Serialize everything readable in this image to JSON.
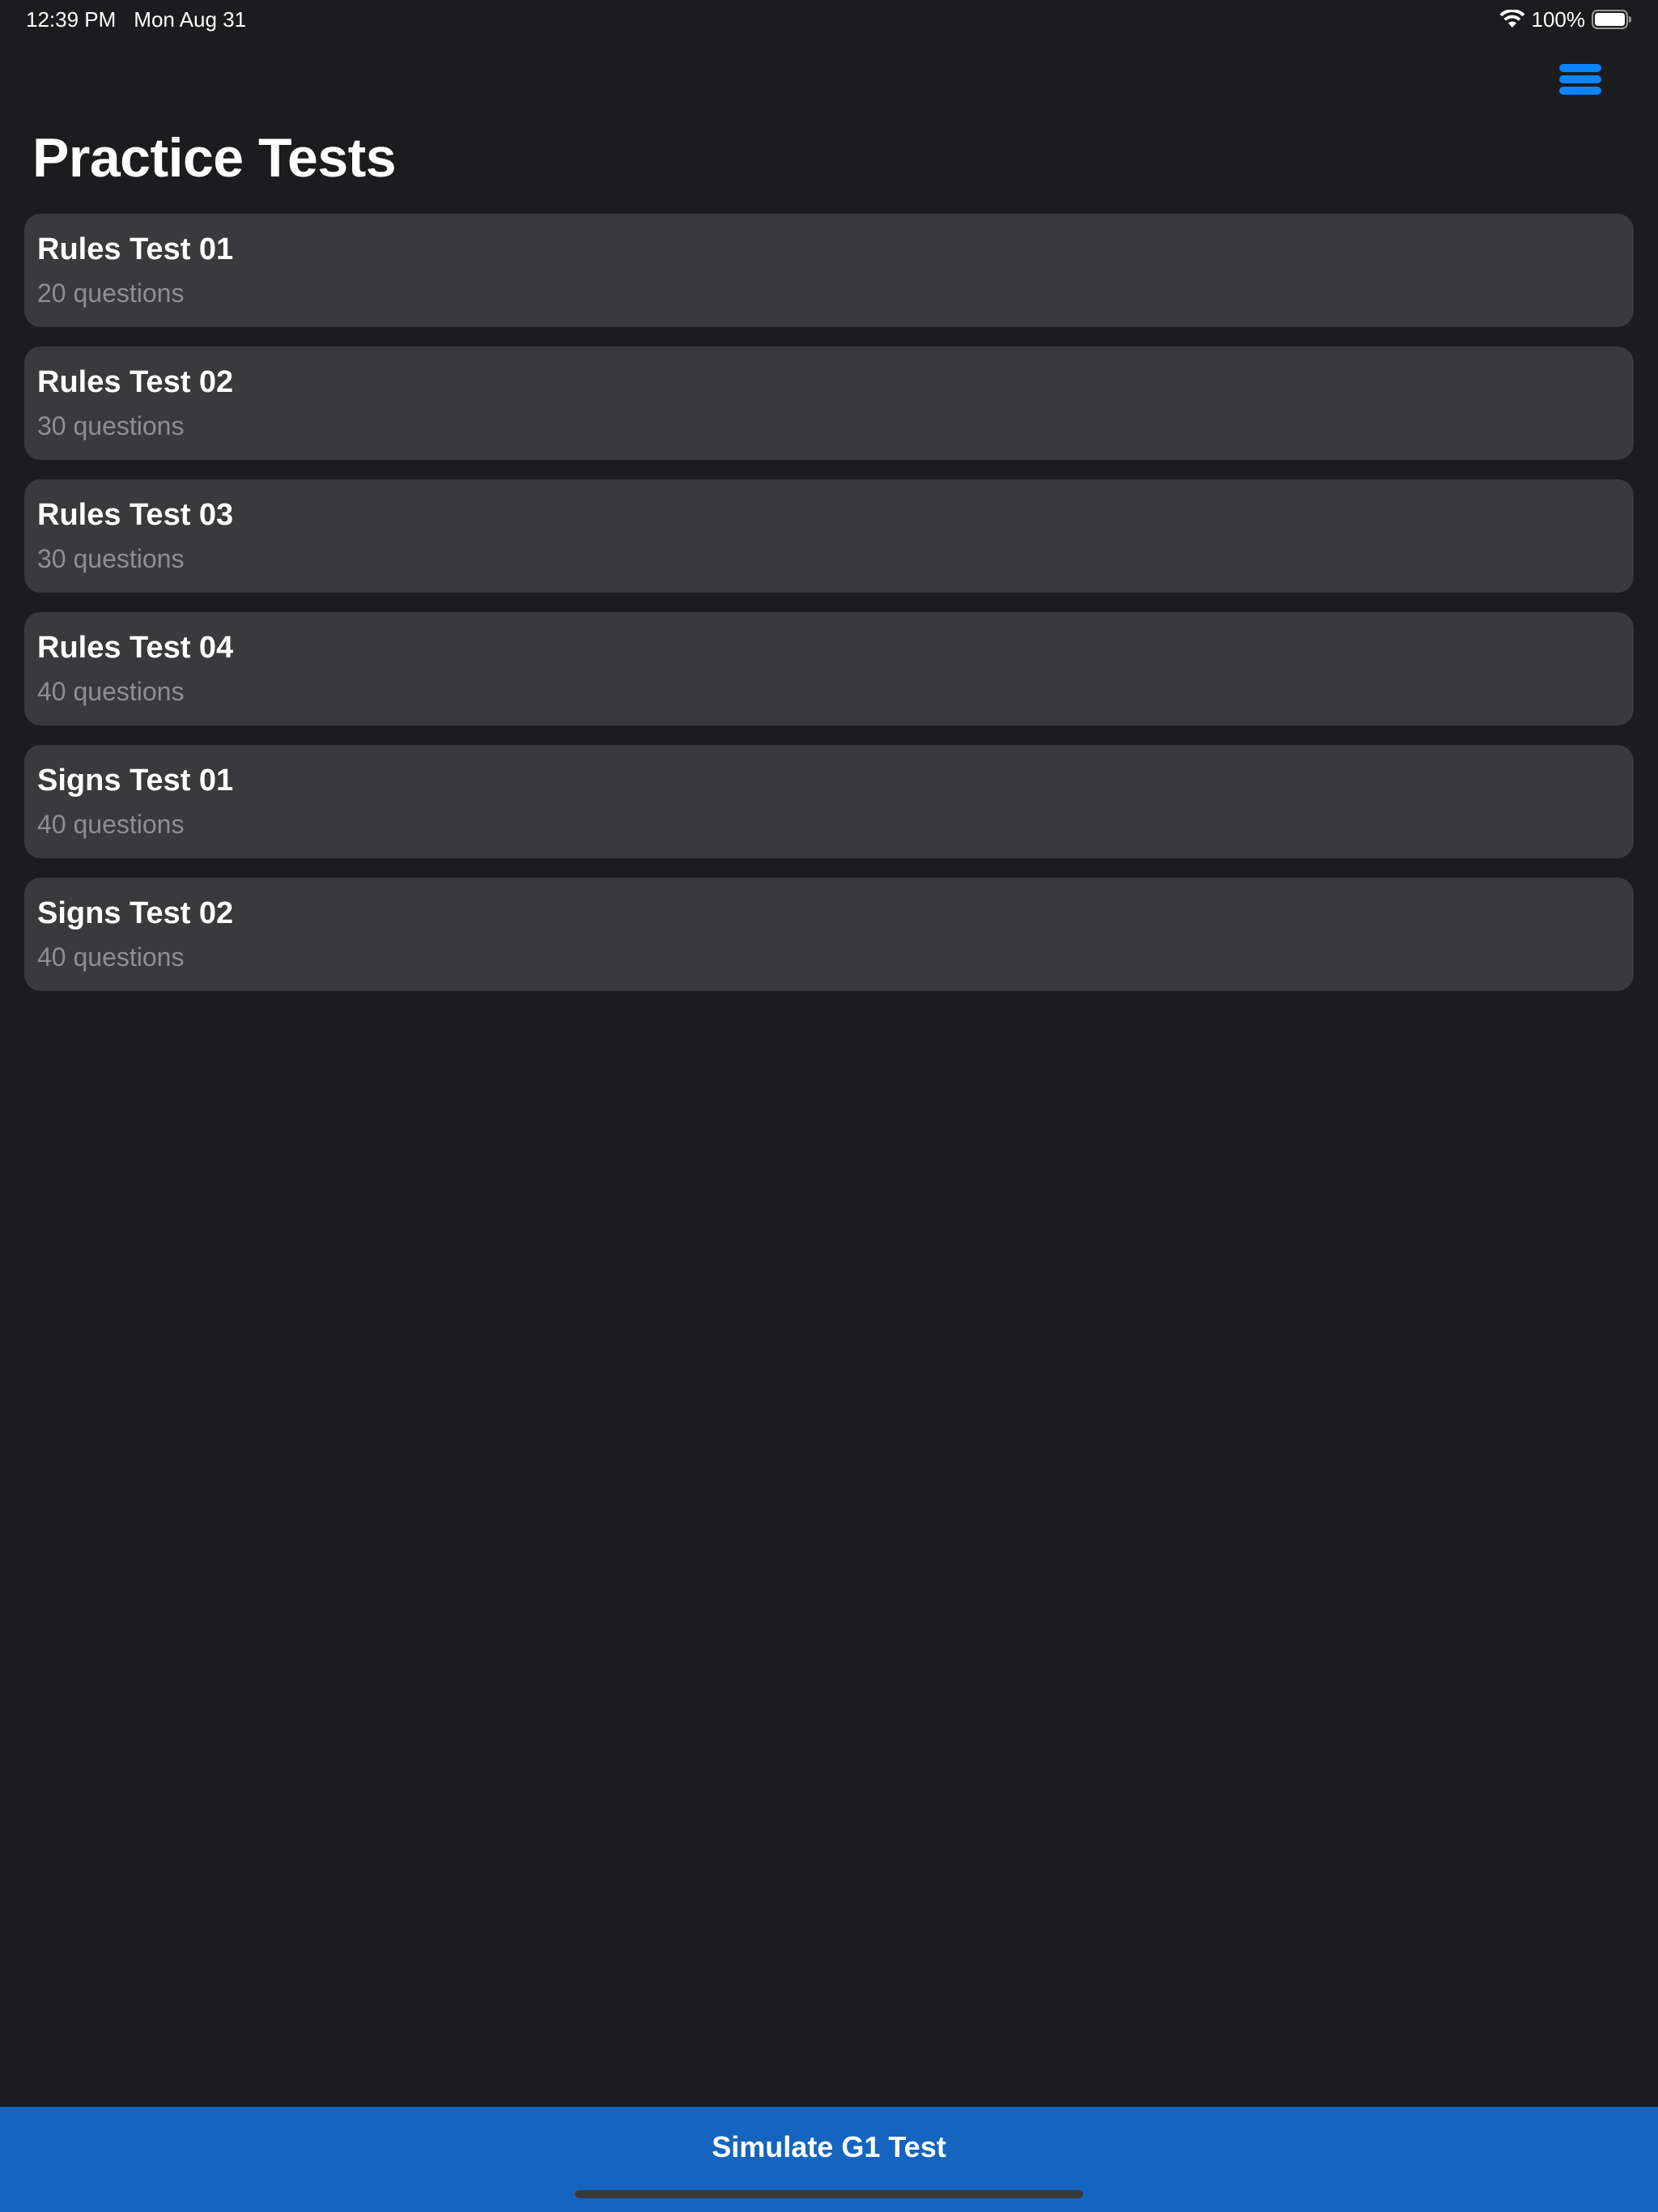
{
  "status_bar": {
    "time": "12:39 PM",
    "date": "Mon Aug 31",
    "battery": "100%"
  },
  "header": {
    "title": "Practice Tests",
    "menu_icon": "hamburger-menu-icon",
    "accent_color": "#0a84ff"
  },
  "tests": [
    {
      "title": "Rules Test 01",
      "subtitle": "20 questions"
    },
    {
      "title": "Rules Test 02",
      "subtitle": "30 questions"
    },
    {
      "title": "Rules Test 03",
      "subtitle": "30 questions"
    },
    {
      "title": "Rules Test 04",
      "subtitle": "40 questions"
    },
    {
      "title": "Signs Test 01",
      "subtitle": "40 questions"
    },
    {
      "title": "Signs Test 02",
      "subtitle": "40 questions"
    }
  ],
  "footer": {
    "button_label": "Simulate G1 Test",
    "button_color": "#1565c0"
  }
}
